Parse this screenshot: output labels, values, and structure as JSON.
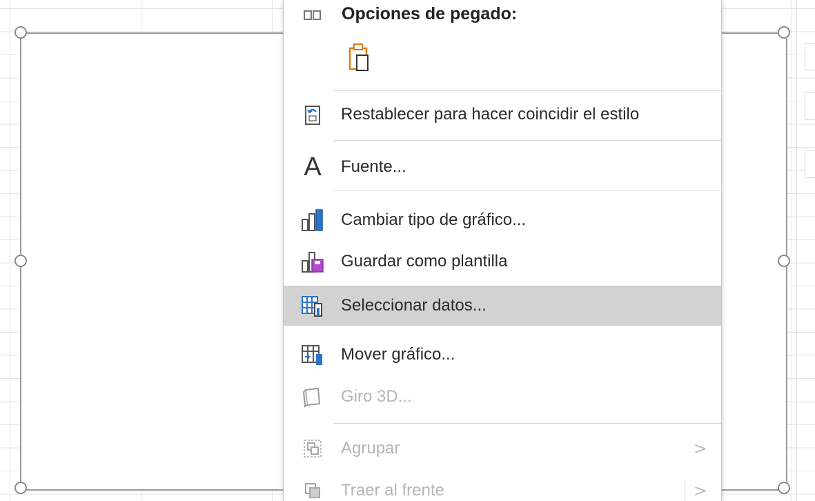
{
  "menu": {
    "header": "Opciones de pegado:",
    "items": [
      {
        "label": "Restablecer para hacer coincidir el estilo",
        "icon": "reset-style-icon",
        "disabled": false
      },
      {
        "label": "Fuente...",
        "icon": "font-icon",
        "disabled": false
      },
      {
        "label": "Cambiar tipo de gráfico...",
        "icon": "chart-type-icon",
        "disabled": false
      },
      {
        "label": "Guardar como plantilla",
        "icon": "save-template-icon",
        "disabled": false
      },
      {
        "label": "Seleccionar datos...",
        "icon": "select-data-icon",
        "disabled": false,
        "highlighted": true
      },
      {
        "label": "Mover gráfico...",
        "icon": "move-chart-icon",
        "disabled": false
      },
      {
        "label": "Giro 3D...",
        "icon": "rotation-3d-icon",
        "disabled": true
      },
      {
        "label": "Agrupar",
        "icon": "group-icon",
        "disabled": true,
        "submenu": true
      },
      {
        "label": "Traer al frente",
        "icon": "bring-front-icon",
        "disabled": true,
        "submenu": true
      }
    ],
    "submenu_glyph": ">",
    "font_icon_glyph": "A"
  },
  "colors": {
    "highlight": "#d2d2d2",
    "accent_blue": "#2b74c7",
    "accent_orange": "#e07a1a",
    "accent_purple": "#b04bc9"
  }
}
